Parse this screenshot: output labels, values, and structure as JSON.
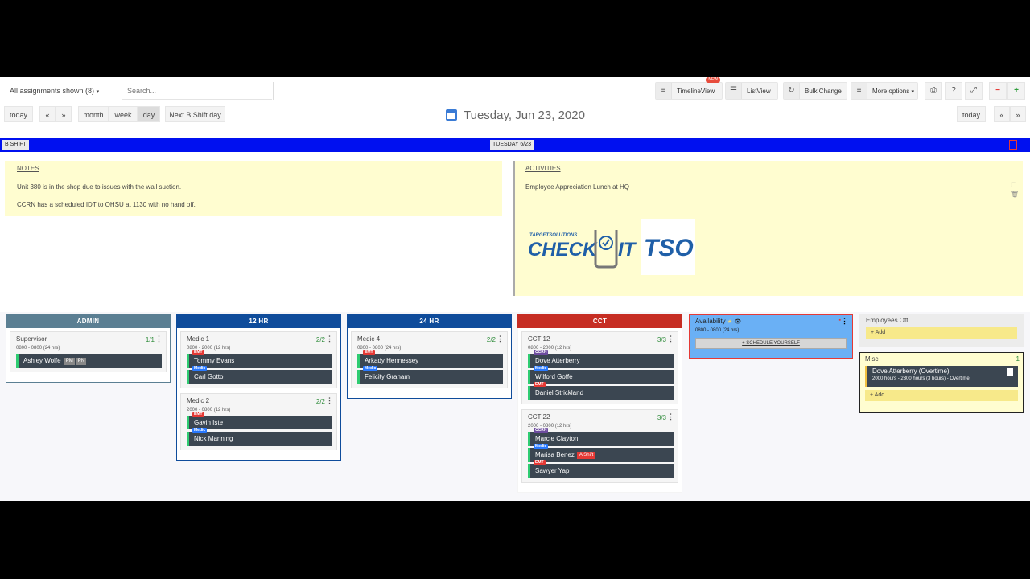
{
  "toolbar": {
    "assignments_select": "All assignments shown (8)",
    "search_placeholder": "Search...",
    "timeline_view": "TimelineView",
    "new_badge": "NEW",
    "list_view": "ListView",
    "bulk_change": "Bulk Change",
    "more_options": "More options",
    "help": "?"
  },
  "nav": {
    "today_left": "today",
    "prev": "«",
    "next": "»",
    "month": "month",
    "week": "week",
    "day": "day",
    "next_shift": "Next B Shift day",
    "date_title": "Tuesday, Jun 23, 2020",
    "today_right": "today"
  },
  "shiftbar": {
    "shift_label": "B SH FT",
    "day_label": "TUESDAY 6/23"
  },
  "notes": {
    "heading": "NOTES",
    "lines": [
      "Unit 380 is in the shop due to issues with the wall suction.",
      "CCRN has a scheduled IDT to OHSU at 1130 with no hand off."
    ]
  },
  "activities": {
    "heading": "ACTIVITIES",
    "lines": [
      "Employee Appreciation Lunch at HQ"
    ],
    "logo_small": "TARGETSOLUTIONS",
    "logo_main": "CHECK",
    "logo_it": "IT",
    "logo_tso": "TSO"
  },
  "columns": {
    "admin": {
      "title": "ADMIN",
      "color": "#5b7f93",
      "cards": [
        {
          "name": "Supervisor",
          "count": "1/1",
          "time": "0800 - 0800 (24 hrs)",
          "slots": [
            {
              "role": "",
              "person": "Ashley Wolfe",
              "tags": [
                "PM",
                "PN"
              ]
            }
          ]
        }
      ]
    },
    "hr12": {
      "title": "12 HR",
      "color": "#0f4c9b",
      "cards": [
        {
          "name": "Medic 1",
          "count": "2/2",
          "time": "0800 - 2000 (12 hrs)",
          "slots": [
            {
              "role": "EMT",
              "person": "Tommy Evans"
            },
            {
              "role": "Medic",
              "person": "Carl Gotto"
            }
          ]
        },
        {
          "name": "Medic 2",
          "count": "2/2",
          "time": "2000 - 0800 (12 hrs)",
          "slots": [
            {
              "role": "EMT",
              "person": "Gavin Iste"
            },
            {
              "role": "Medic",
              "person": "Nick Manning"
            }
          ]
        }
      ]
    },
    "hr24": {
      "title": "24 HR",
      "color": "#0f4c9b",
      "cards": [
        {
          "name": "Medic 4",
          "count": "2/2",
          "time": "0800 - 0800 (24 hrs)",
          "slots": [
            {
              "role": "EMT",
              "person": "Arkady Hennessey"
            },
            {
              "role": "Medic",
              "person": "Felicity Graham"
            }
          ]
        }
      ]
    },
    "cct": {
      "title": "CCT",
      "color": "#c62d23",
      "cards": [
        {
          "name": "CCT 12",
          "count": "3/3",
          "time": "0800 - 2000 (12 hrs)",
          "slots": [
            {
              "role": "CCRN",
              "person": "Dove Atterberry"
            },
            {
              "role": "Medic",
              "person": "Wilford Goffe"
            },
            {
              "role": "EMT",
              "person": "Daniel Strickland"
            }
          ]
        },
        {
          "name": "CCT 22",
          "count": "3/3",
          "time": "2000 - 0800 (12 hrs)",
          "slots": [
            {
              "role": "CCRN",
              "person": "Marcie Clayton"
            },
            {
              "role": "Medic",
              "person": "Marisa Benez",
              "badge": "A Shift"
            },
            {
              "role": "EMT",
              "person": "Sawyer Yap"
            }
          ]
        }
      ]
    }
  },
  "availability": {
    "name": "Availability",
    "time": "0800 - 0800 (24 hrs)",
    "button": "+ SCHEDULE YOURSELF"
  },
  "employees_off": {
    "name": "Employees Off",
    "add": "+ Add"
  },
  "misc": {
    "name": "Misc",
    "count": "1",
    "person": "Dove Atterberry (Overtime)",
    "detail": "2000 hours - 2300 hours (3 hours) - Overtime",
    "add": "+ Add"
  }
}
